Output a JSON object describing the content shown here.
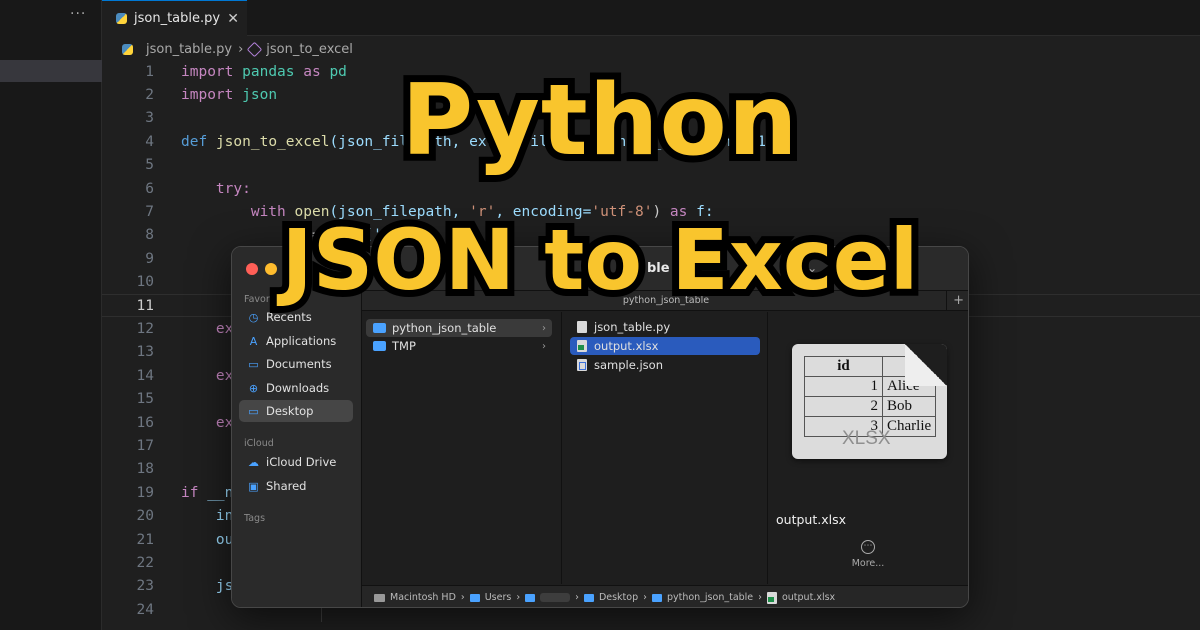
{
  "sidebar": {
    "more": "···"
  },
  "tab": {
    "filename": "json_table.py",
    "close": "✕"
  },
  "breadcrumb": {
    "file": "json_table.py",
    "sep": "›",
    "symbol": "json_to_excel"
  },
  "code": {
    "lines": [
      {
        "n": "1"
      },
      {
        "n": "2"
      },
      {
        "n": "3"
      },
      {
        "n": "4"
      },
      {
        "n": "5"
      },
      {
        "n": "6"
      },
      {
        "n": "7"
      },
      {
        "n": "8"
      },
      {
        "n": "9"
      },
      {
        "n": "10"
      },
      {
        "n": "11"
      },
      {
        "n": "12"
      },
      {
        "n": "13"
      },
      {
        "n": "14"
      },
      {
        "n": "15"
      },
      {
        "n": "16"
      },
      {
        "n": "17"
      },
      {
        "n": "18"
      },
      {
        "n": "19"
      },
      {
        "n": "20"
      },
      {
        "n": "21"
      },
      {
        "n": "22"
      },
      {
        "n": "23"
      },
      {
        "n": "24"
      }
    ],
    "t": {
      "import1": "import",
      "pandas": "pandas",
      "as": "as",
      "pd": "pd",
      "import2": "import",
      "json": "json",
      "def": "def",
      "fname": "json_to_excel",
      "l4rest": "(json_filepath, excel_filepath, sheet_name='Sheet1",
      "try": "try:",
      "with": "with",
      "open": "open",
      "l7a": "(json_filepath, ",
      "r": "'r'",
      "l7b": ", encoding=",
      "utf8": "'utf-8'",
      "l7c": ") ",
      "as2": "as",
      "f": " f:",
      "l8": "j",
      "l8b": "  =  ",
      "l8c": "l",
      "l8d": "  ('f",
      "ex": "ex",
      "if": "if",
      "ifrest": " __n",
      "in": "in",
      "ou": "ou",
      "js": "js"
    }
  },
  "title": {
    "line1": "Python",
    "line2": "JSON to Excel"
  },
  "finder": {
    "sidebar": {
      "favorites": "Favorites",
      "items": [
        {
          "label": "Recents",
          "icon": "clock-icon",
          "glyph": "◷"
        },
        {
          "label": "Applications",
          "icon": "applications-icon",
          "glyph": "A"
        },
        {
          "label": "Documents",
          "icon": "document-icon",
          "glyph": "▭"
        },
        {
          "label": "Downloads",
          "icon": "download-icon",
          "glyph": "⊕"
        },
        {
          "label": "Desktop",
          "icon": "desktop-icon",
          "glyph": "▭"
        }
      ],
      "icloud": "iCloud",
      "icloud_items": [
        {
          "label": "iCloud Drive",
          "icon": "cloud-icon",
          "glyph": "☁"
        },
        {
          "label": "Shared",
          "icon": "shared-folder-icon",
          "glyph": "▣"
        }
      ],
      "tags": "Tags"
    },
    "toolbar": {
      "title_fragment": "ble"
    },
    "pathbar": {
      "label": "python_json_table",
      "plus": "+"
    },
    "col1": [
      {
        "label": "python_json_table",
        "chevron": "›"
      },
      {
        "label": "TMP",
        "chevron": "›"
      }
    ],
    "col2": [
      {
        "label": "json_table.py"
      },
      {
        "label": "output.xlsx"
      },
      {
        "label": "sample.json"
      }
    ],
    "preview": {
      "header": "id",
      "rows": [
        {
          "id": "1",
          "name": "Alice"
        },
        {
          "id": "2",
          "name": "Bob"
        },
        {
          "id": "3",
          "name": "Charlie"
        }
      ],
      "type_label": "XLSX",
      "filename": "output.xlsx",
      "more": "More...",
      "more_glyph": "⋯"
    },
    "status": {
      "hd": "Macintosh HD",
      "users": "Users",
      "desktop": "Desktop",
      "folder": "python_json_table",
      "file": "output.xlsx",
      "sep": "›"
    },
    "colors": {
      "close": "#ff5f57",
      "minimize": "#febc2e",
      "zoom": "#28c840",
      "selection": "#2a5bbd"
    }
  }
}
